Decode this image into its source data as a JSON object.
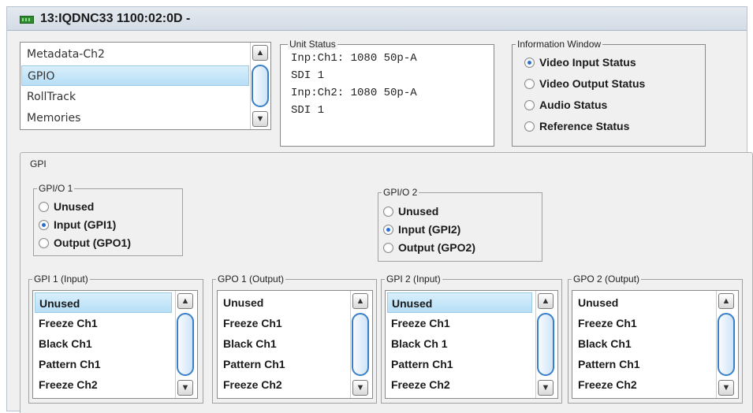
{
  "window": {
    "title": "13:IQDNC33  1100:02:0D  -"
  },
  "nav_list": {
    "items": [
      "Metadata-Ch2",
      "GPIO",
      "RollTrack",
      "Memories"
    ],
    "selected": "GPIO"
  },
  "unit_status": {
    "caption": "Unit Status",
    "lines": [
      "Inp:Ch1: 1080 50p-A",
      "SDI 1",
      "Inp:Ch2: 1080 50p-A",
      "SDI 1"
    ]
  },
  "info_window": {
    "caption": "Information Window",
    "options": [
      "Video Input Status",
      "Video Output Status",
      "Audio Status",
      "Reference Status"
    ],
    "selected": "Video Input Status"
  },
  "gpi": {
    "caption": "GPI",
    "gpio1": {
      "caption": "GPI/O 1",
      "options": [
        "Unused",
        "Input (GPI1)",
        "Output (GPO1)"
      ],
      "selected": "Input (GPI1)"
    },
    "gpio2": {
      "caption": "GPI/O 2",
      "options": [
        "Unused",
        "Input (GPI2)",
        "Output (GPO2)"
      ],
      "selected": "Input (GPI2)"
    },
    "lists": [
      {
        "caption": "GPI 1 (Input)",
        "items": [
          "Unused",
          "Freeze Ch1",
          "Black Ch1",
          "Pattern Ch1",
          "Freeze Ch2"
        ],
        "selected": "Unused"
      },
      {
        "caption": "GPO 1 (Output)",
        "items": [
          "Unused",
          "Freeze Ch1",
          "Black Ch1",
          "Pattern Ch1",
          "Freeze Ch2"
        ],
        "selected": ""
      },
      {
        "caption": "GPI 2 (Input)",
        "items": [
          "Unused",
          "Freeze Ch1",
          "Black Ch 1",
          "Pattern Ch1",
          "Freeze Ch2"
        ],
        "selected": "Unused"
      },
      {
        "caption": "GPO 2 (Output)",
        "items": [
          "Unused",
          "Freeze Ch1",
          "Black Ch1",
          "Pattern Ch1",
          "Freeze Ch2"
        ],
        "selected": ""
      }
    ]
  },
  "colors": {
    "selection": "#b6def6",
    "radio_on": "#2a6fcf",
    "scroll_thumb": "#3a80c8"
  },
  "icons": {
    "title": "device-board-icon",
    "scroll_up": "chevron-up-icon",
    "scroll_down": "chevron-down-icon"
  }
}
